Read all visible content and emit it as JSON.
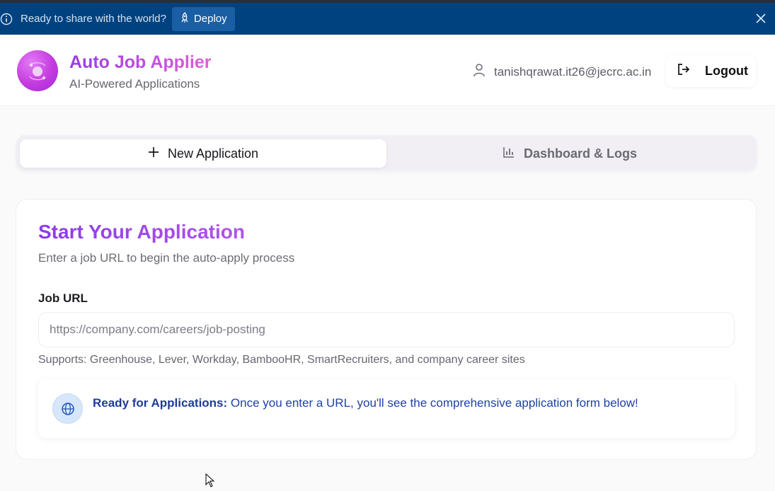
{
  "banner": {
    "text": "Ready to share with the world?",
    "deploy_label": "Deploy",
    "info_icon": "info-circle-icon",
    "deploy_icon": "rocket-icon",
    "close_icon": "close-icon",
    "bg_color": "#004280"
  },
  "header": {
    "app_title": "Auto Job Applier",
    "app_subtitle": "AI-Powered Applications",
    "user_email": "tanishqrawat.it26@jecrc.ac.in",
    "logout_label": "Logout",
    "logo_icon": "sparkle-orbit-icon",
    "user_icon": "user-icon",
    "logout_icon": "logout-icon"
  },
  "tabs": [
    {
      "label": "New Application",
      "icon": "plus-icon",
      "active": true
    },
    {
      "label": "Dashboard & Logs",
      "icon": "bar-chart-icon",
      "active": false
    }
  ],
  "card": {
    "title": "Start Your Application",
    "description": "Enter a job URL to begin the auto-apply process",
    "field_label": "Job URL",
    "input_placeholder": "https://company.com/careers/job-posting",
    "input_value": "",
    "support_text": "Supports: Greenhouse, Lever, Workday, BambooHR, SmartRecruiters, and company career sites",
    "notice_strong": "Ready for Applications:",
    "notice_text": " Once you enter a URL, you'll see the comprehensive application form below!",
    "notice_icon": "globe-icon"
  },
  "colors": {
    "accent_purple": "#8b3be8",
    "notice_blue": "#1f42a3"
  }
}
